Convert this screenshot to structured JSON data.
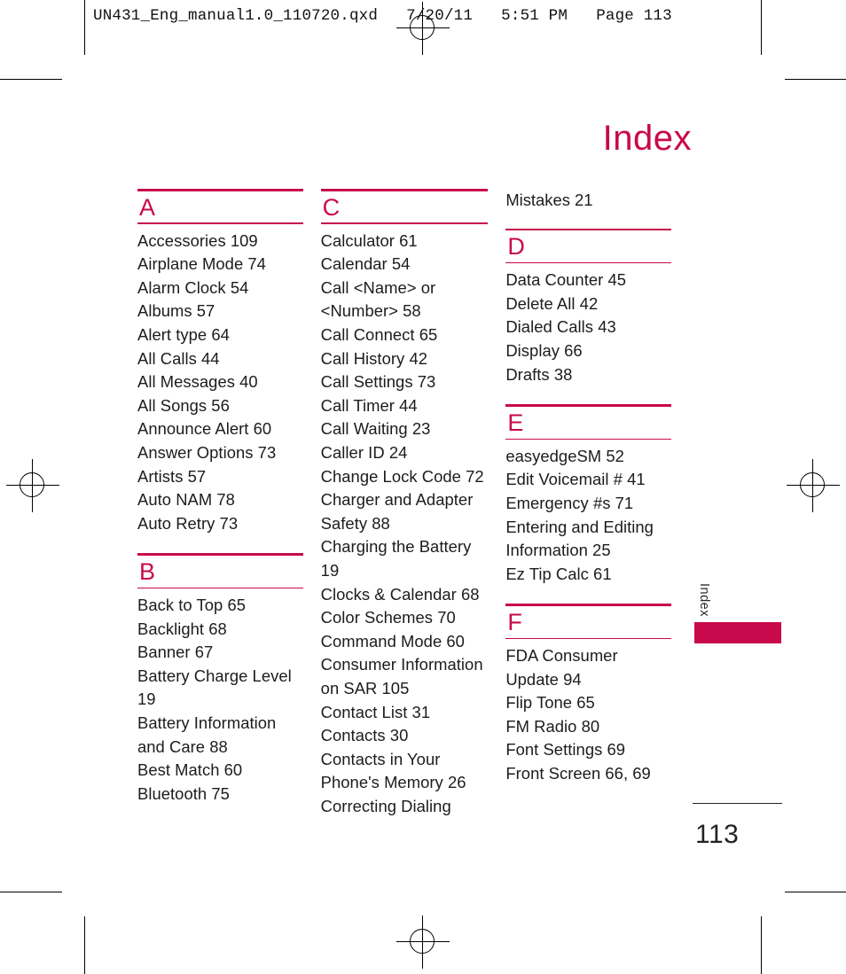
{
  "header": {
    "slug": "UN431_Eng_manual1.0_110720.qxd   7/20/11   5:51 PM   Page 113"
  },
  "page": {
    "title": "Index",
    "margin_tab_label": "Index",
    "folio": "113",
    "accent_color": "#C8094B",
    "text_color": "#1c1c1c"
  },
  "columns": [
    {
      "name": "column-left",
      "loose_entries": [],
      "sections": [
        {
          "letter": "A",
          "entries": [
            "Accessories 109",
            "Airplane Mode 74",
            "Alarm Clock 54",
            "Albums 57",
            "Alert type 64",
            "All Calls 44",
            "All Messages 40",
            "All Songs 56",
            "Announce Alert 60",
            "Answer Options 73",
            "Artists 57",
            "Auto NAM 78",
            "Auto Retry 73"
          ]
        },
        {
          "letter": "B",
          "entries": [
            "Back to Top 65",
            "Backlight 68",
            "Banner 67",
            "Battery Charge Level 19",
            "Battery Information and Care 88",
            "Best Match 60",
            "Bluetooth 75"
          ]
        }
      ]
    },
    {
      "name": "column-middle",
      "loose_entries": [],
      "sections": [
        {
          "letter": "C",
          "entries": [
            "Calculator 61",
            "Calendar 54",
            "Call <Name> or <Number> 58",
            "Call Connect 65",
            "Call History 42",
            "Call Settings 73",
            "Call Timer 44",
            "Call Waiting 23",
            "Caller ID 24",
            "Change Lock Code 72",
            "Charger and Adapter Safety 88",
            "Charging the Battery 19",
            "Clocks & Calendar 68",
            "Color Schemes 70",
            "Command Mode 60",
            "Consumer Information on SAR 105",
            "Contact List 31",
            "Contacts 30",
            "Contacts in Your Phone's Memory 26",
            "Correcting Dialing"
          ]
        }
      ]
    },
    {
      "name": "column-right",
      "loose_entries": [
        "Mistakes 21"
      ],
      "sections": [
        {
          "letter": "D",
          "entries": [
            "Data Counter 45",
            "Delete All 42",
            "Dialed Calls 43",
            "Display 66",
            "Drafts 38"
          ]
        },
        {
          "letter": "E",
          "entries": [
            "easyedgeSM 52",
            "Edit Voicemail # 41",
            "Emergency #s 71",
            "Entering and Editing Information 25",
            "Ez Tip Calc 61"
          ]
        },
        {
          "letter": "F",
          "entries": [
            "FDA Consumer Update 94",
            "Flip Tone 65",
            "FM Radio 80",
            "Font Settings 69",
            "Front Screen 66, 69"
          ]
        }
      ]
    }
  ]
}
